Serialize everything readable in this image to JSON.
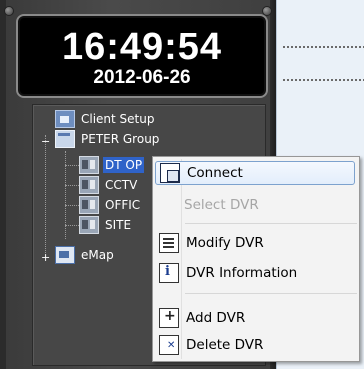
{
  "clock": {
    "time": "16:49:54",
    "date": "2012-06-26"
  },
  "tree": {
    "items": [
      {
        "label": "Client Setup",
        "icon": "client-setup-icon"
      },
      {
        "label": "PETER Group",
        "icon": "group-icon",
        "expander": "−"
      },
      {
        "label": "DT OP",
        "icon": "dvr-icon",
        "selected": true
      },
      {
        "label": "CCTV",
        "icon": "dvr-icon"
      },
      {
        "label": "OFFIC",
        "icon": "dvr-icon"
      },
      {
        "label": "SITE",
        "icon": "dvr-icon"
      },
      {
        "label": "eMap",
        "icon": "emap-icon",
        "expander": "+"
      }
    ]
  },
  "context_menu": {
    "items": [
      {
        "label": "Connect",
        "icon": "connect-icon",
        "state": "hover"
      },
      {
        "label": "Select DVR",
        "state": "disabled"
      },
      {
        "label": "Modify DVR",
        "icon": "modify-dvr-icon"
      },
      {
        "label": "DVR Information",
        "icon": "dvr-info-icon"
      },
      {
        "label": "Add DVR",
        "icon": "add-dvr-icon"
      },
      {
        "label": "Delete DVR",
        "icon": "delete-dvr-icon"
      }
    ]
  },
  "colors": {
    "selection": "#2f63c9",
    "panel": "#444444",
    "clock_bg": "#000000",
    "menu_hover_border": "#7da2ce"
  }
}
